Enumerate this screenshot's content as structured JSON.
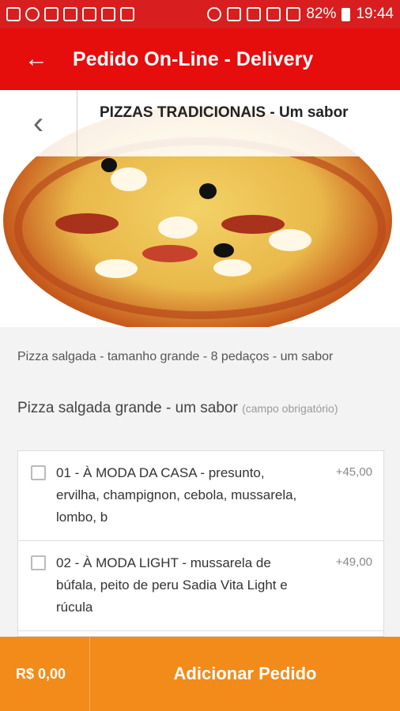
{
  "status_bar": {
    "battery": "82%",
    "time": "19:44",
    "icons": [
      "mail-icon",
      "whatsapp-icon",
      "image-icon",
      "gallery-icon",
      "calendar-icon",
      "gmail-icon",
      "play-store-icon",
      "alarm-icon",
      "wifi-icon",
      "data-icon",
      "signal-icon",
      "screenshot-icon"
    ]
  },
  "app_bar": {
    "title": "Pedido On-Line - Delivery"
  },
  "category": {
    "title": "PIZZAS TRADICIONAIS - Um sabor"
  },
  "product": {
    "description": "Pizza salgada - tamanho grande - 8 pedaços - um sabor",
    "section_title": "Pizza salgada grande - um sabor",
    "section_hint": "(campo obrigatório)"
  },
  "options": [
    {
      "name": "01 - À MODA DA CASA",
      "details": " - presunto, ervilha, champignon, cebola, mussarela, lombo, b",
      "price": "+45,00"
    },
    {
      "name": "02 - À MODA LIGHT",
      "details": " - mussarela de búfala, peito de peru Sadia Vita Light e rúcula",
      "price": "+49,00"
    }
  ],
  "bottom_bar": {
    "total": "R$ 0,00",
    "add_label": "Adicionar Pedido"
  },
  "colors": {
    "status_bar": "#d81e1e",
    "app_bar": "#e60d0d",
    "bottom_bar": "#f28b1a"
  }
}
